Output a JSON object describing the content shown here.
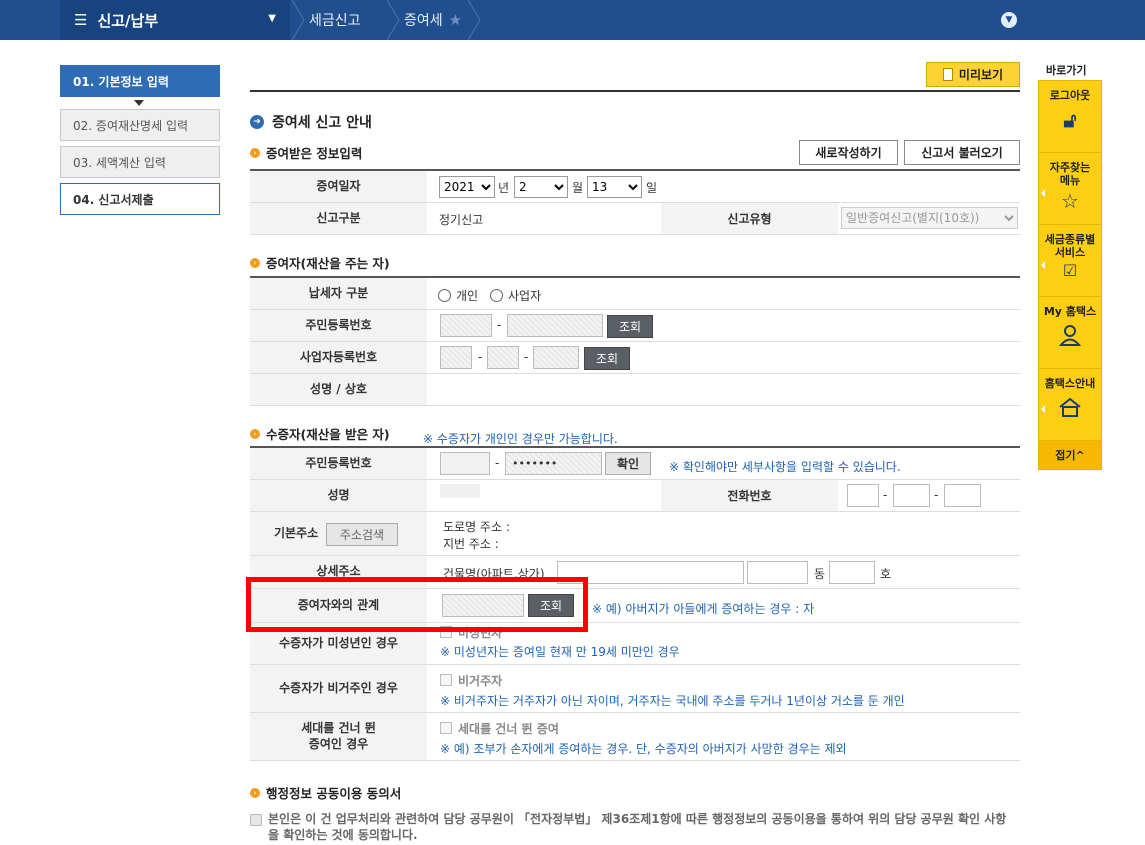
{
  "topbar": {
    "menu_label": "신고/납부",
    "crumbs": [
      "세금신고",
      "증여세"
    ]
  },
  "steps": [
    {
      "label": "01. 기본정보 입력"
    },
    {
      "label": "02. 증여재산명세 입력"
    },
    {
      "label": "03. 세액계산 입력"
    },
    {
      "label": "04. 신고서제출"
    }
  ],
  "header": {
    "preview": "미리보기",
    "guide_title": "증여세 신고 안내",
    "new_btn": "새로작성하기",
    "load_btn": "신고서 불러오기"
  },
  "section1": {
    "title": "증여받은 정보입력",
    "date_label": "증여일자",
    "year": "2021",
    "year_unit": "년",
    "month": "2",
    "month_unit": "월",
    "day": "13",
    "day_unit": "일",
    "type_label": "신고구분",
    "type_value": "정기신고",
    "kind_label": "신고유형",
    "kind_value": "일반증여신고(별지(10호))"
  },
  "section2": {
    "title": "증여자(재산을 주는 자)",
    "taxpayer_label": "납세자 구분",
    "opt_individual": "개인",
    "opt_business": "사업자",
    "rrn_label": "주민등록번호",
    "brn_label": "사업자등록번호",
    "lookup": "조회",
    "name_label": "성명 / 상호"
  },
  "section3": {
    "title": "수증자(재산을 받은 자)",
    "title_note": "※ 수증자가 개인인 경우만 가능합니다.",
    "rrn_label": "주민등록번호",
    "rrn_masked": "•••••••",
    "confirm": "확인",
    "confirm_note": "※ 확인해야만 세부사항을 입력할 수 있습니다.",
    "name_label": "성명",
    "phone_label": "전화번호",
    "addr_label": "기본주소",
    "addr_search": "주소검색",
    "road_addr": "도로명 주소 :",
    "lot_addr": "지번 주소 :",
    "detail_label": "상세주소",
    "building": "건물명(아파트,상가)",
    "dong": "동",
    "ho": "호",
    "relation_label": "증여자와의 관계",
    "lookup": "조회",
    "relation_note": "※ 예) 아버지가 아들에게 증여하는 경우 : 자",
    "minor_label": "수증자가 미성년인 경우",
    "minor_chk": "미성년자",
    "minor_note": "※ 미성년자는 증여일 현재 만 19세 미만인 경우",
    "nonres_label": "수증자가 비거주인 경우",
    "nonres_chk": "비거주자",
    "nonres_note": "※ 비거주자는 거주자가 아닌 자이며, 거주자는 국내에 주소를 두거나 1년이상 거소를 둔 개인",
    "skip_label_1": "세대를 건너 뛴",
    "skip_label_2": "증여인 경우",
    "skip_chk": "세대를 건너 뛴 증여",
    "skip_note": "※ 예) 조부가 손자에게 증여하는 경우. 단, 수증자의 아버지가 사망한 경우는 제외"
  },
  "section4": {
    "title": "행정정보 공동이용 동의서",
    "agree_text": "본인은 이 건 업무처리와 관련하여 담당 공무원이 「전자정부법」 제36조제1항에 따른 행정정보의 공동이용을 통하여 위의 담당 공무원 확인 사항을 확인하는 것에 동의합니다."
  },
  "quick": {
    "title": "바로가기",
    "items": [
      {
        "label": "로그아웃",
        "icon": "lock-icon"
      },
      {
        "label": "자주찾는 메뉴",
        "icon": "star-icon"
      },
      {
        "label": "세금종류별 서비스",
        "icon": "checkbox-icon"
      },
      {
        "label": "My 홈택스",
        "icon": "person-icon"
      },
      {
        "label": "홈택스안내",
        "icon": "house-icon"
      }
    ],
    "fold": "접기^"
  }
}
